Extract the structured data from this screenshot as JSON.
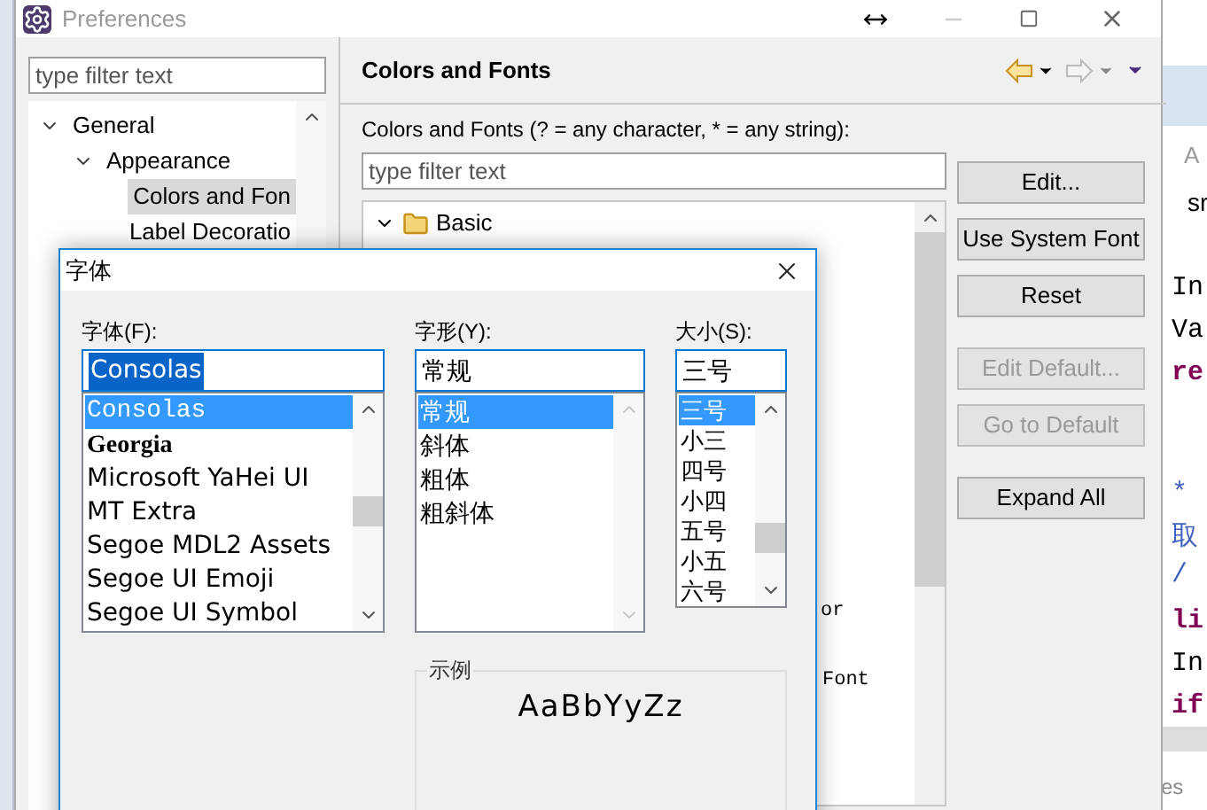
{
  "preferences": {
    "title": "Preferences",
    "filter_placeholder": "type filter text",
    "tree": [
      {
        "label": "General",
        "expanded": true,
        "selected": false,
        "children": [
          {
            "label": "Appearance",
            "expanded": true,
            "selected": false,
            "children": [
              {
                "label": "Colors and Fon",
                "selected": true
              },
              {
                "label": "Label Decoratio",
                "selected": false
              }
            ]
          }
        ]
      }
    ],
    "page_title": "Colors and Fonts",
    "description": "Colors and Fonts (? = any character, * = any string):",
    "page_filter_placeholder": "type filter text",
    "theme_tree": [
      {
        "label": "Basic",
        "expanded": true
      }
    ],
    "covered_fragments": [
      "or",
      "Font"
    ],
    "buttons": [
      {
        "label": "Edit...",
        "disabled": false
      },
      {
        "label": "Use System Font",
        "disabled": false
      },
      {
        "label": "Reset",
        "disabled": false
      },
      {
        "label": "Edit Default...",
        "disabled": true
      },
      {
        "label": "Go to Default",
        "disabled": true
      },
      {
        "label": "Expand All",
        "disabled": false
      }
    ]
  },
  "editor": {
    "tab": "A",
    "project": "sr",
    "code": [
      {
        "text": "In",
        "kind": "plain"
      },
      {
        "text": "Va",
        "kind": "plain"
      },
      {
        "text": "re",
        "kind": "keyword"
      },
      {
        "text": "*",
        "kind": "comment"
      },
      {
        "text": "取",
        "kind": "comment"
      },
      {
        "text": "/",
        "kind": "comment"
      },
      {
        "text": "li",
        "kind": "keyword"
      },
      {
        "text": "In",
        "kind": "plain"
      },
      {
        "text": "if",
        "kind": "keyword"
      }
    ],
    "status": "es"
  },
  "font_dialog": {
    "title": "字体",
    "font": {
      "label": "字体(F):",
      "value": "Consolas",
      "items": [
        {
          "label": "Consolas",
          "selected": true,
          "kind": "mono"
        },
        {
          "label": "Georgia",
          "selected": false,
          "kind": "serif"
        },
        {
          "label": "Microsoft YaHei UI",
          "selected": false,
          "kind": "sans"
        },
        {
          "label": "MT Extra",
          "selected": false,
          "kind": "sans"
        },
        {
          "label": "Segoe MDL2 Assets",
          "selected": false,
          "kind": "sans"
        },
        {
          "label": "Segoe UI Emoji",
          "selected": false,
          "kind": "sans"
        },
        {
          "label": "Segoe UI Symbol",
          "selected": false,
          "kind": "sans"
        }
      ]
    },
    "style": {
      "label": "字形(Y):",
      "value": "常规",
      "items": [
        {
          "label": "常规",
          "selected": true
        },
        {
          "label": "斜体",
          "selected": false
        },
        {
          "label": "粗体",
          "selected": false
        },
        {
          "label": "粗斜体",
          "selected": false
        }
      ]
    },
    "size": {
      "label": "大小(S):",
      "value": "三号",
      "items": [
        {
          "label": "三号",
          "selected": true
        },
        {
          "label": "小三",
          "selected": false
        },
        {
          "label": "四号",
          "selected": false
        },
        {
          "label": "小四",
          "selected": false
        },
        {
          "label": "五号",
          "selected": false
        },
        {
          "label": "小五",
          "selected": false
        },
        {
          "label": "六号",
          "selected": false
        }
      ]
    },
    "sample": {
      "label": "示例",
      "text": "AaBbYyZz"
    }
  }
}
